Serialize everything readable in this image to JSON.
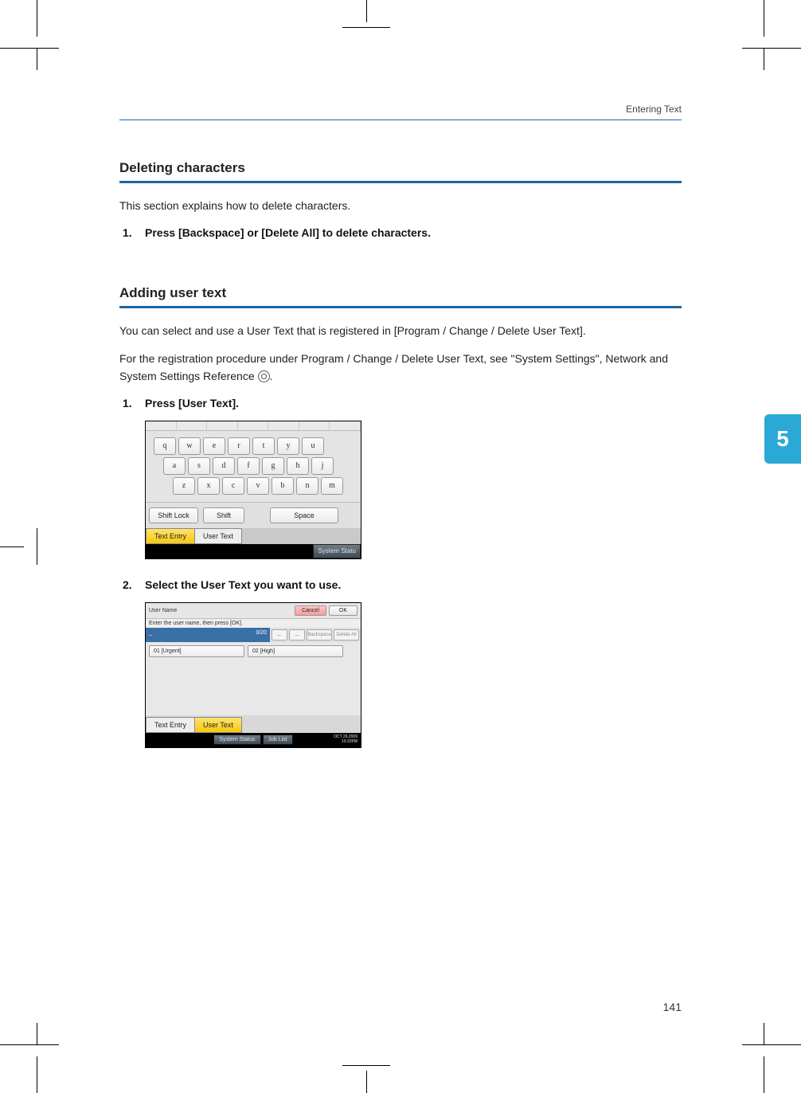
{
  "runningHead": "Entering Text",
  "chapterNumber": "5",
  "pageNumber": "141",
  "section1": {
    "heading": "Deleting characters",
    "intro": "This section explains how to delete characters.",
    "steps": [
      {
        "num": "1.",
        "text": "Press [Backspace] or [Delete All] to delete characters."
      }
    ]
  },
  "section2": {
    "heading": "Adding user text",
    "para1": "You can select and use a User Text that is registered in [Program / Change / Delete User Text].",
    "para2a": "For the registration procedure under Program / Change / Delete User Text, see \"System Settings\", Network and System Settings Reference",
    "para2b": ".",
    "steps": [
      {
        "num": "1.",
        "text": "Press [User Text]."
      },
      {
        "num": "2.",
        "text": "Select the User Text you want to use."
      }
    ]
  },
  "shot1": {
    "row1": [
      "q",
      "w",
      "e",
      "r",
      "t",
      "y",
      "u"
    ],
    "row2": [
      "a",
      "s",
      "d",
      "f",
      "g",
      "h",
      "j"
    ],
    "row3": [
      "z",
      "x",
      "c",
      "v",
      "b",
      "n",
      "m"
    ],
    "shiftLock": "Shift Lock",
    "shift": "Shift",
    "space": "Space",
    "tabTextEntry": "Text Entry",
    "tabUserText": "User Text",
    "systemStatus": "System Statu"
  },
  "shot2": {
    "title": "User Name",
    "cancel": "Cancel",
    "ok": "OK",
    "instruction": "Enter the user name, then press [OK].",
    "valueField": "_",
    "counter": "0/20",
    "navLeft": "←",
    "navRight": "→",
    "navBackspace": "Backspace",
    "navDeleteAll": "Delete All",
    "item1": "01 [Urgent]",
    "item2": "02 [High]",
    "tabTextEntry": "Text Entry",
    "tabUserText": "User Text",
    "bottomSystemStatus": "System Status",
    "bottomJobList": "Job List",
    "dateLine1": "OCT  26,2009",
    "dateLine2": "10:32PM"
  }
}
